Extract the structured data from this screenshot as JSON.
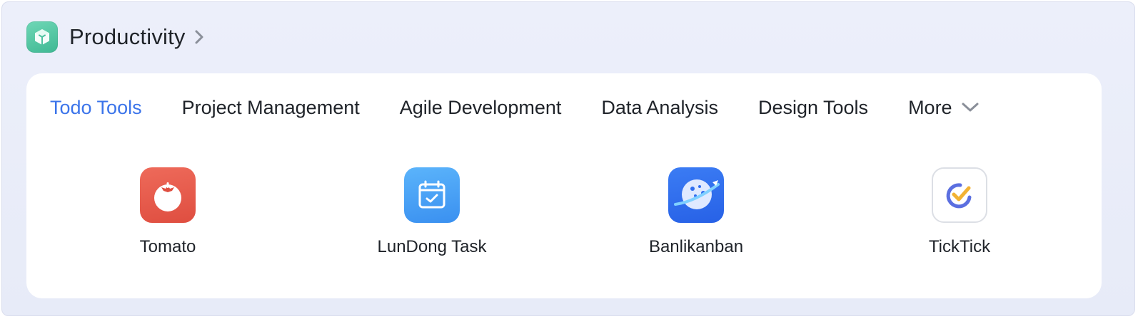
{
  "header": {
    "title": "Productivity",
    "icon": "green-cube-app-icon"
  },
  "tabs": [
    {
      "label": "Todo Tools",
      "active": true
    },
    {
      "label": "Project Management",
      "active": false
    },
    {
      "label": "Agile Development",
      "active": false
    },
    {
      "label": "Data Analysis",
      "active": false
    },
    {
      "label": "Design Tools",
      "active": false
    }
  ],
  "more": {
    "label": "More"
  },
  "apps": [
    {
      "name": "Tomato",
      "icon": "tomato-icon",
      "color": "#e5584a"
    },
    {
      "name": "LunDong Task",
      "icon": "calendar-check-icon",
      "color": "#3d9cf5"
    },
    {
      "name": "Banlikanban",
      "icon": "planet-icon",
      "color": "#2f6ef0"
    },
    {
      "name": "TickTick",
      "icon": "ticktick-check-icon",
      "color": "#ffffff"
    }
  ],
  "colors": {
    "accent": "#3b74ea",
    "text": "#1f2329",
    "background": "#eceffa"
  }
}
